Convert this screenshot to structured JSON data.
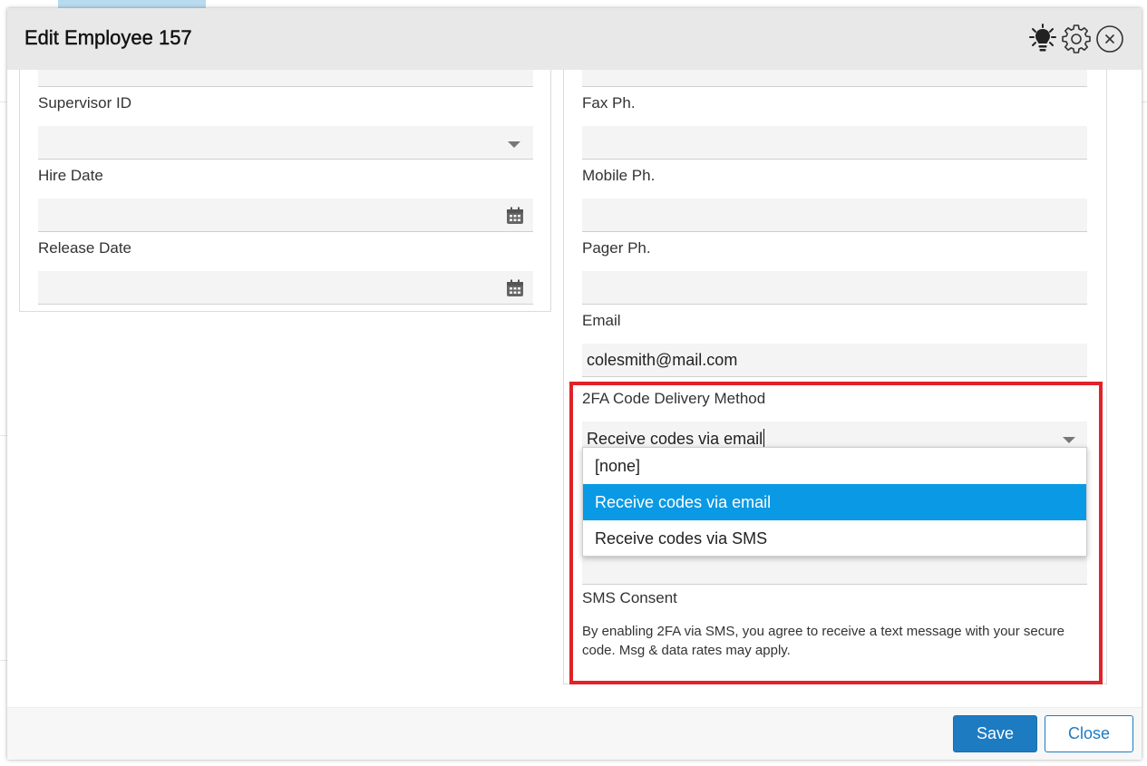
{
  "modal": {
    "title": "Edit Employee 157"
  },
  "header_icons": [
    "lightbulb-icon",
    "gear-icon",
    "close-icon"
  ],
  "left_fields": {
    "supervisor_id": {
      "label": "Supervisor ID",
      "value": ""
    },
    "hire_date": {
      "label": "Hire Date",
      "value": ""
    },
    "release_date": {
      "label": "Release Date",
      "value": ""
    }
  },
  "right_fields": {
    "fax": {
      "label": "Fax Ph.",
      "value": ""
    },
    "mobile": {
      "label": "Mobile Ph.",
      "value": ""
    },
    "pager": {
      "label": "Pager Ph.",
      "value": ""
    },
    "email": {
      "label": "Email",
      "value": "colesmith@mail.com"
    },
    "twofa": {
      "label": "2FA Code Delivery Method",
      "value": "Receive codes via email",
      "options": [
        "[none]",
        "Receive codes via email",
        "Receive codes via SMS"
      ],
      "selected_index": 1
    },
    "sms_consent": {
      "label": "SMS Consent",
      "text": "By enabling 2FA via SMS, you agree to receive a text message with your secure code. Msg & data rates may apply."
    }
  },
  "footer": {
    "save_label": "Save",
    "close_label": "Close"
  },
  "colors": {
    "primary": "#1d7bc2",
    "selected_option": "#0a99e4",
    "highlight": "#e0232a",
    "header_bg": "#e8e8e8"
  }
}
